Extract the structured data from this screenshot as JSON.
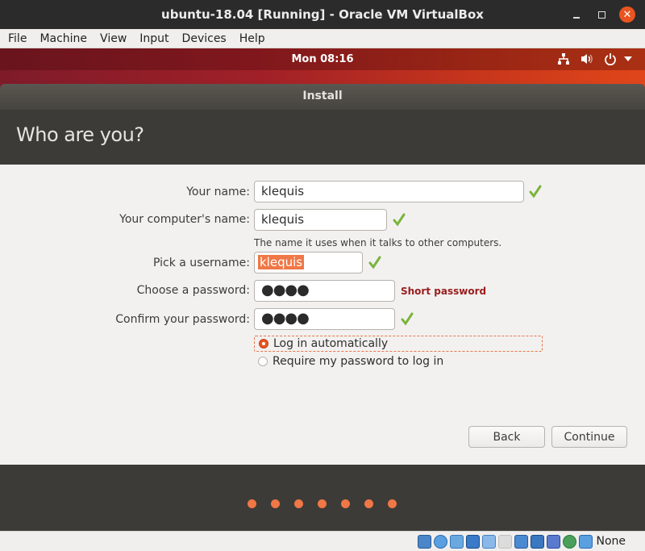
{
  "window": {
    "title": "ubuntu-18.04 [Running] - Oracle VM VirtualBox",
    "controls": [
      "minimize",
      "maximize",
      "close"
    ]
  },
  "menubar": {
    "items": [
      "File",
      "Machine",
      "View",
      "Input",
      "Devices",
      "Help"
    ]
  },
  "gnome_topbar": {
    "clock": "Mon 08:16",
    "tray_icons": [
      "network-icon",
      "volume-icon",
      "power-icon",
      "dropdown-arrow-icon"
    ]
  },
  "installer": {
    "window_title": "Install",
    "page_title": "Who are you?",
    "fields": [
      {
        "label": "Your name:",
        "value": "klequis",
        "valid": true
      },
      {
        "label": "Your computer's name:",
        "value": "klequis",
        "valid": true,
        "hint": "The name it uses when it talks to other computers."
      },
      {
        "label": "Pick a username:",
        "value": "klequis",
        "valid": true,
        "selected": true
      },
      {
        "label": "Choose a password:",
        "value": "●●●●",
        "warning": "Short password"
      },
      {
        "label": "Confirm your password:",
        "value": "●●●●",
        "valid": true
      }
    ],
    "login_options": [
      {
        "label": "Log in automatically",
        "checked": true
      },
      {
        "label": "Require my password to log in",
        "checked": false
      }
    ],
    "buttons": {
      "back": "Back",
      "continue": "Continue"
    },
    "progress": {
      "steps_total": 7
    }
  },
  "statusbar": {
    "icons": [
      "hard-disk-icon",
      "optical-disk-icon",
      "audio-icon",
      "network-adapters-icon",
      "usb-icon",
      "shared-folders-icon",
      "display-icon",
      "video-capture-icon",
      "cpu-virtualization-icon",
      "mouse-integration-icon",
      "keyboard-capture-icon"
    ],
    "host_key": "None"
  },
  "colors": {
    "accent": "#e95420",
    "warning": "#991d1d",
    "valid_check": "#7ab43c",
    "selection": "#f07746"
  }
}
